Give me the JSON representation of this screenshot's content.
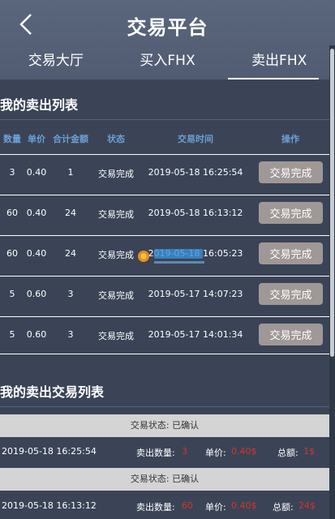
{
  "header": {
    "title": "交易平台",
    "back_icon": "chevron-left-icon"
  },
  "tabs": [
    {
      "label": "交易大厅",
      "active": false
    },
    {
      "label": "买入FHX",
      "active": false
    },
    {
      "label": "卖出FHX",
      "active": true
    }
  ],
  "sell_list": {
    "title": "我的卖出列表",
    "columns": [
      "数量",
      "单价",
      "合计金额",
      "状态",
      "交易时间",
      "操作"
    ],
    "rows": [
      {
        "qty": "3",
        "price": "0.40",
        "total": "1",
        "status": "交易完成",
        "time": "2019-05-18 16:25:54",
        "action": "交易完成"
      },
      {
        "qty": "60",
        "price": "0.40",
        "total": "24",
        "status": "交易完成",
        "time": "2019-05-18 16:13:12",
        "action": "交易完成"
      },
      {
        "qty": "60",
        "price": "0.40",
        "total": "24",
        "status": "交易完成",
        "time": "2019-05-18 16:05:23",
        "action": "交易完成"
      },
      {
        "qty": "5",
        "price": "0.60",
        "total": "3",
        "status": "交易完成",
        "time": "2019-05-17 14:07:23",
        "action": "交易完成"
      },
      {
        "qty": "5",
        "price": "0.60",
        "total": "3",
        "status": "交易完成",
        "time": "2019-05-17 14:01:34",
        "action": "交易完成"
      }
    ]
  },
  "trade_list": {
    "title": "我的卖出交易列表",
    "records": [
      {
        "status": "交易状态: 已确认",
        "time": "2019-05-18 16:25:54",
        "qty_label": "卖出数量:",
        "qty": "3",
        "price_label": "单价:",
        "price": "0.40$",
        "total_label": "总额:",
        "total": "1$"
      },
      {
        "status": "交易状态: 已确认",
        "time": "2019-05-18 16:13:12",
        "qty_label": "卖出数量:",
        "qty": "60",
        "price_label": "单价:",
        "price": "0.40$",
        "total_label": "总额:",
        "total": "24$"
      }
    ]
  },
  "colors": {
    "header_bg": "#56627a",
    "content_bg": "#3a4456",
    "column_header": "#6e9fd4",
    "action_button": "#9f9896",
    "status_bar": "#d4d4d4",
    "value_red": "#d9332b"
  }
}
